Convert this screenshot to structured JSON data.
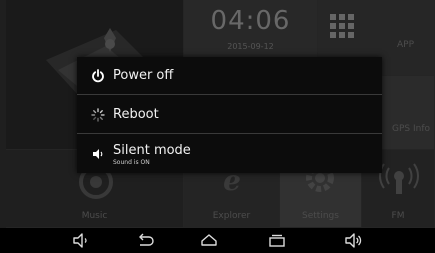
{
  "status": {
    "time": "04:06",
    "date": "2015-09-12"
  },
  "tiles": {
    "app": "APP",
    "gps": "GPS Info",
    "music": "Music",
    "explorer": "Explorer",
    "settings": "Settings",
    "fm": "FM"
  },
  "dialog": {
    "items": [
      {
        "label": "Power off",
        "icon": "power-icon"
      },
      {
        "label": "Reboot",
        "icon": "reboot-spinner-icon"
      },
      {
        "label": "Silent mode",
        "sublabel": "Sound is ON",
        "icon": "speaker-icon"
      }
    ]
  },
  "navbar": {
    "icons": [
      "volume-down-icon",
      "back-icon",
      "home-icon",
      "recent-apps-icon",
      "volume-up-icon"
    ]
  },
  "colors": {
    "dialog_bg": "#0c0c0c",
    "dialog_text": "#f2f2f2",
    "divider": "#3a3a3a"
  }
}
